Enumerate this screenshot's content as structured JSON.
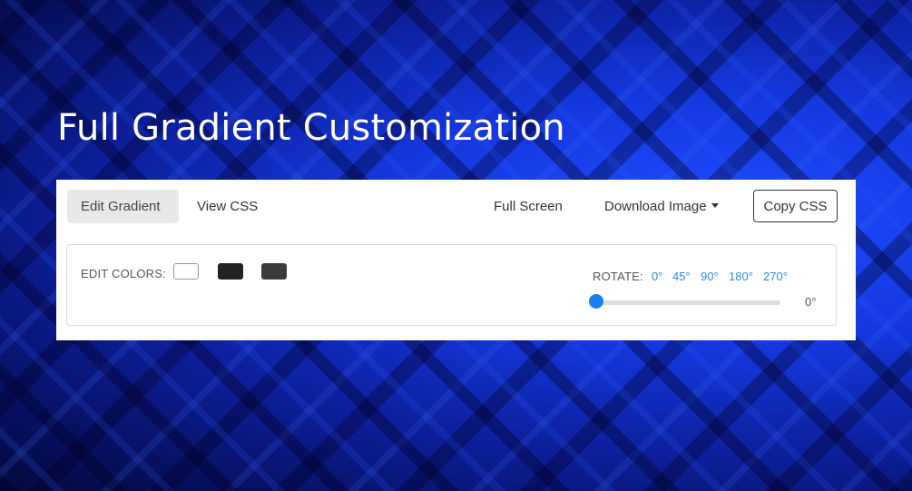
{
  "hero": {
    "title": "Full Gradient Customization"
  },
  "toolbar": {
    "tab_edit": "Edit Gradient",
    "tab_view": "View CSS",
    "full_screen": "Full Screen",
    "download": "Download Image",
    "copy": "Copy CSS"
  },
  "editor": {
    "edit_colors_label": "EDIT COLORS:",
    "swatches": [
      {
        "color": "#ffffff",
        "border": "#999999"
      },
      {
        "color": "#222222",
        "border": "#222222"
      },
      {
        "color": "#3b3b3b",
        "border": "#3b3b3b"
      }
    ],
    "rotate_label": "ROTATE:",
    "angles": [
      "0°",
      "45°",
      "90°",
      "180°",
      "270°"
    ],
    "rotation": {
      "value": 0,
      "min": 0,
      "max": 360,
      "display": "0°"
    }
  },
  "colors": {
    "accent": "#1a7ff0",
    "link": "#2a8ee8"
  }
}
